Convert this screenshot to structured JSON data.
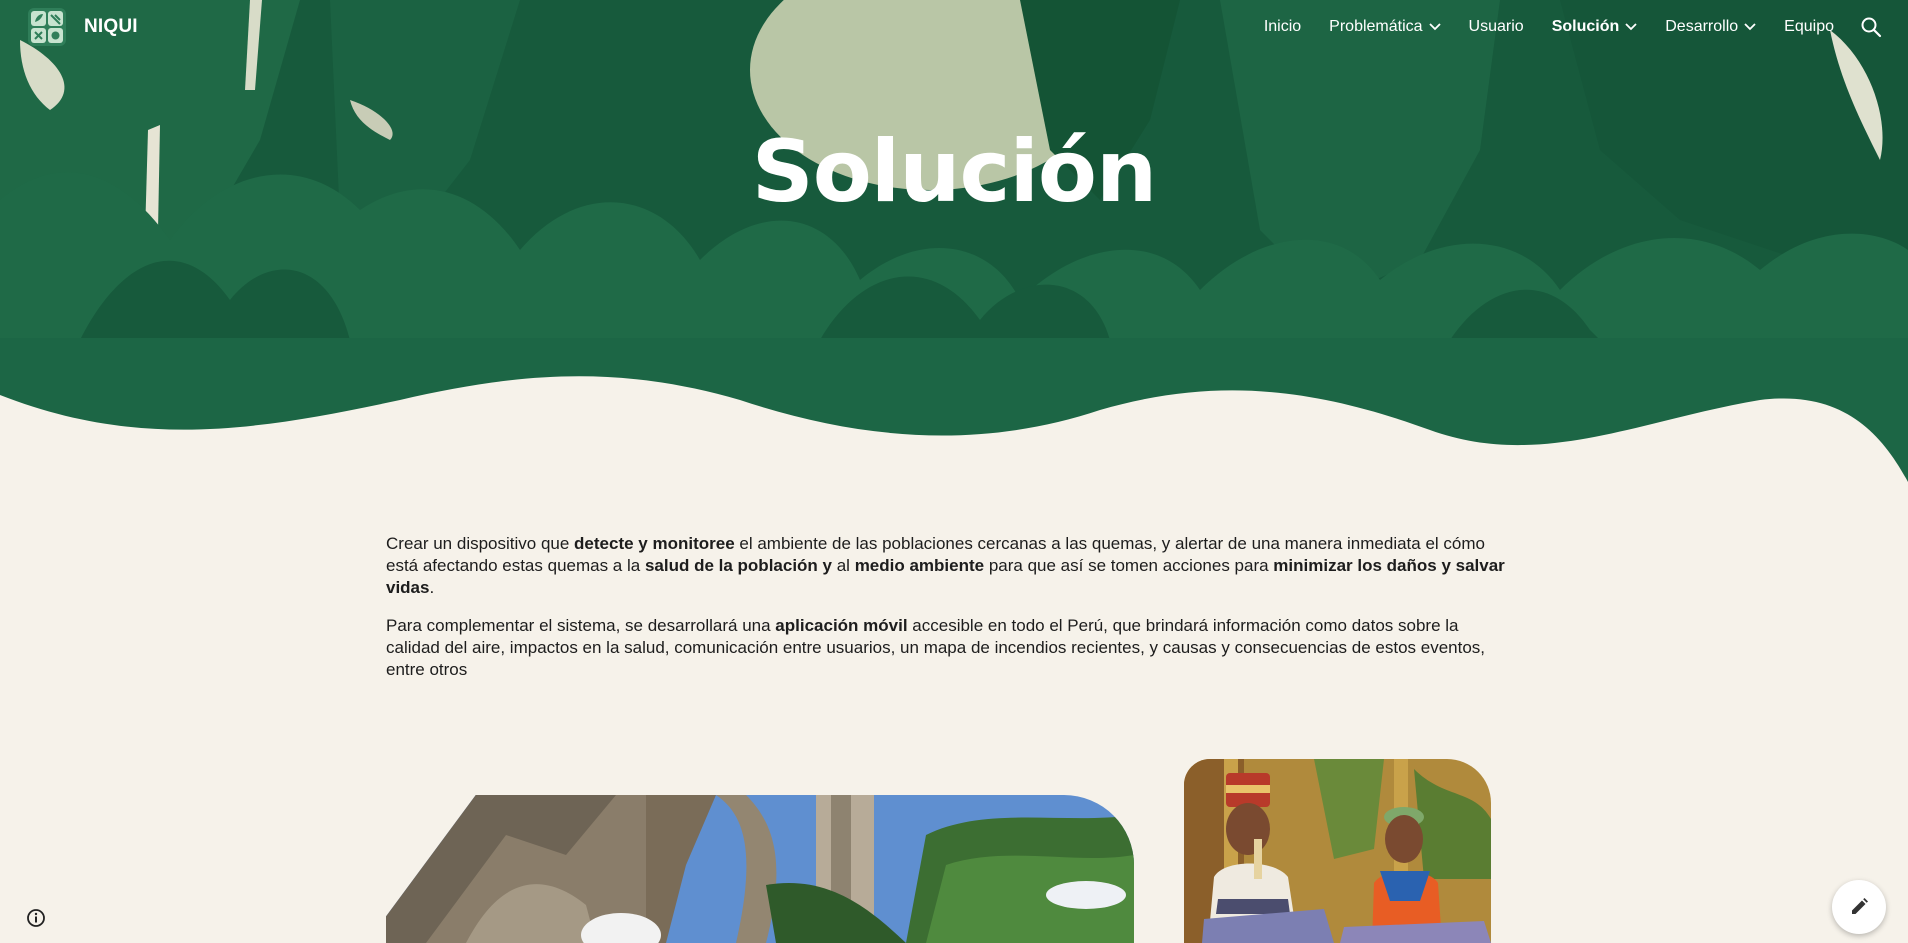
{
  "site": {
    "name": "NIQUI"
  },
  "nav": {
    "items": [
      {
        "label": "Inicio",
        "has_menu": false,
        "active": false
      },
      {
        "label": "Problemática",
        "has_menu": true,
        "active": false
      },
      {
        "label": "Usuario",
        "has_menu": false,
        "active": false
      },
      {
        "label": "Solución",
        "has_menu": true,
        "active": true
      },
      {
        "label": "Desarrollo",
        "has_menu": true,
        "active": false
      },
      {
        "label": "Equipo",
        "has_menu": false,
        "active": false
      }
    ]
  },
  "hero": {
    "title": "Solución"
  },
  "content": {
    "p1": [
      {
        "t": "Crear un dispositivo que ",
        "b": false
      },
      {
        "t": "detecte y monitoree",
        "b": true
      },
      {
        "t": " el ambiente de las poblaciones cercanas a las quemas, y alertar de una manera inmediata el cómo está afectando estas quemas a la ",
        "b": false
      },
      {
        "t": "salud de la población y",
        "b": true
      },
      {
        "t": " al ",
        "b": false
      },
      {
        "t": "medio ambiente",
        "b": true
      },
      {
        "t": " para que así se tomen acciones para ",
        "b": false
      },
      {
        "t": "minimizar los daños y salvar vidas",
        "b": true
      },
      {
        "t": ".",
        "b": false
      }
    ],
    "p2": [
      {
        "t": "Para complementar el sistema, se desarrollará una ",
        "b": false
      },
      {
        "t": "aplicación móvil",
        "b": true
      },
      {
        "t": " accesible en todo el Perú, que brindará información como datos sobre la calidad del aire, impactos en la salud, comunicación entre usuarios, un mapa de incendios recientes, y causas y consecuencias de estos eventos, entre otros",
        "b": false
      }
    ]
  },
  "colors": {
    "hero_green": "#175a3c",
    "leaf_light": "#236e4a",
    "leaf_dark": "#0f4a30",
    "background": "#f6f2ea",
    "text": "#1d1d1d"
  },
  "icons": {
    "logo": "leaf-grid-logo",
    "menu_chevron": "chevron-down-icon",
    "search": "search-icon",
    "info": "info-icon",
    "edit": "pencil-icon"
  }
}
